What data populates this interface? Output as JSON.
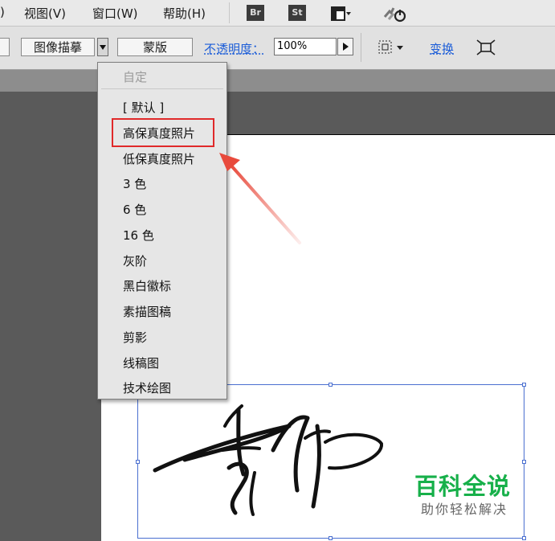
{
  "menubar": {
    "cutoff": ")",
    "items": [
      "视图(V)",
      "窗口(W)",
      "帮助(H)"
    ],
    "apps": [
      "Br",
      "St"
    ]
  },
  "toolbar": {
    "trace_button": "图像描摹",
    "mask_button": "蒙版",
    "opacity_label": "不透明度：",
    "opacity_value": "100%",
    "transform_label": "变换"
  },
  "dropdown": {
    "header": "自定",
    "items": [
      "[ 默认 ]",
      "高保真度照片",
      "低保真度照片",
      "3 色",
      "6 色",
      "16 色",
      "灰阶",
      "黑白徽标",
      "素描图稿",
      "剪影",
      "线稿图",
      "技术绘图"
    ],
    "highlighted_index": 1
  },
  "watermark": {
    "title": "百科全说",
    "subtitle": "助你轻松解决"
  },
  "colors": {
    "highlight_box": "#e0292a",
    "annotation_arrow": "#e84a3c",
    "watermark_green": "#17b04a",
    "link_blue": "#1d5ed8"
  }
}
